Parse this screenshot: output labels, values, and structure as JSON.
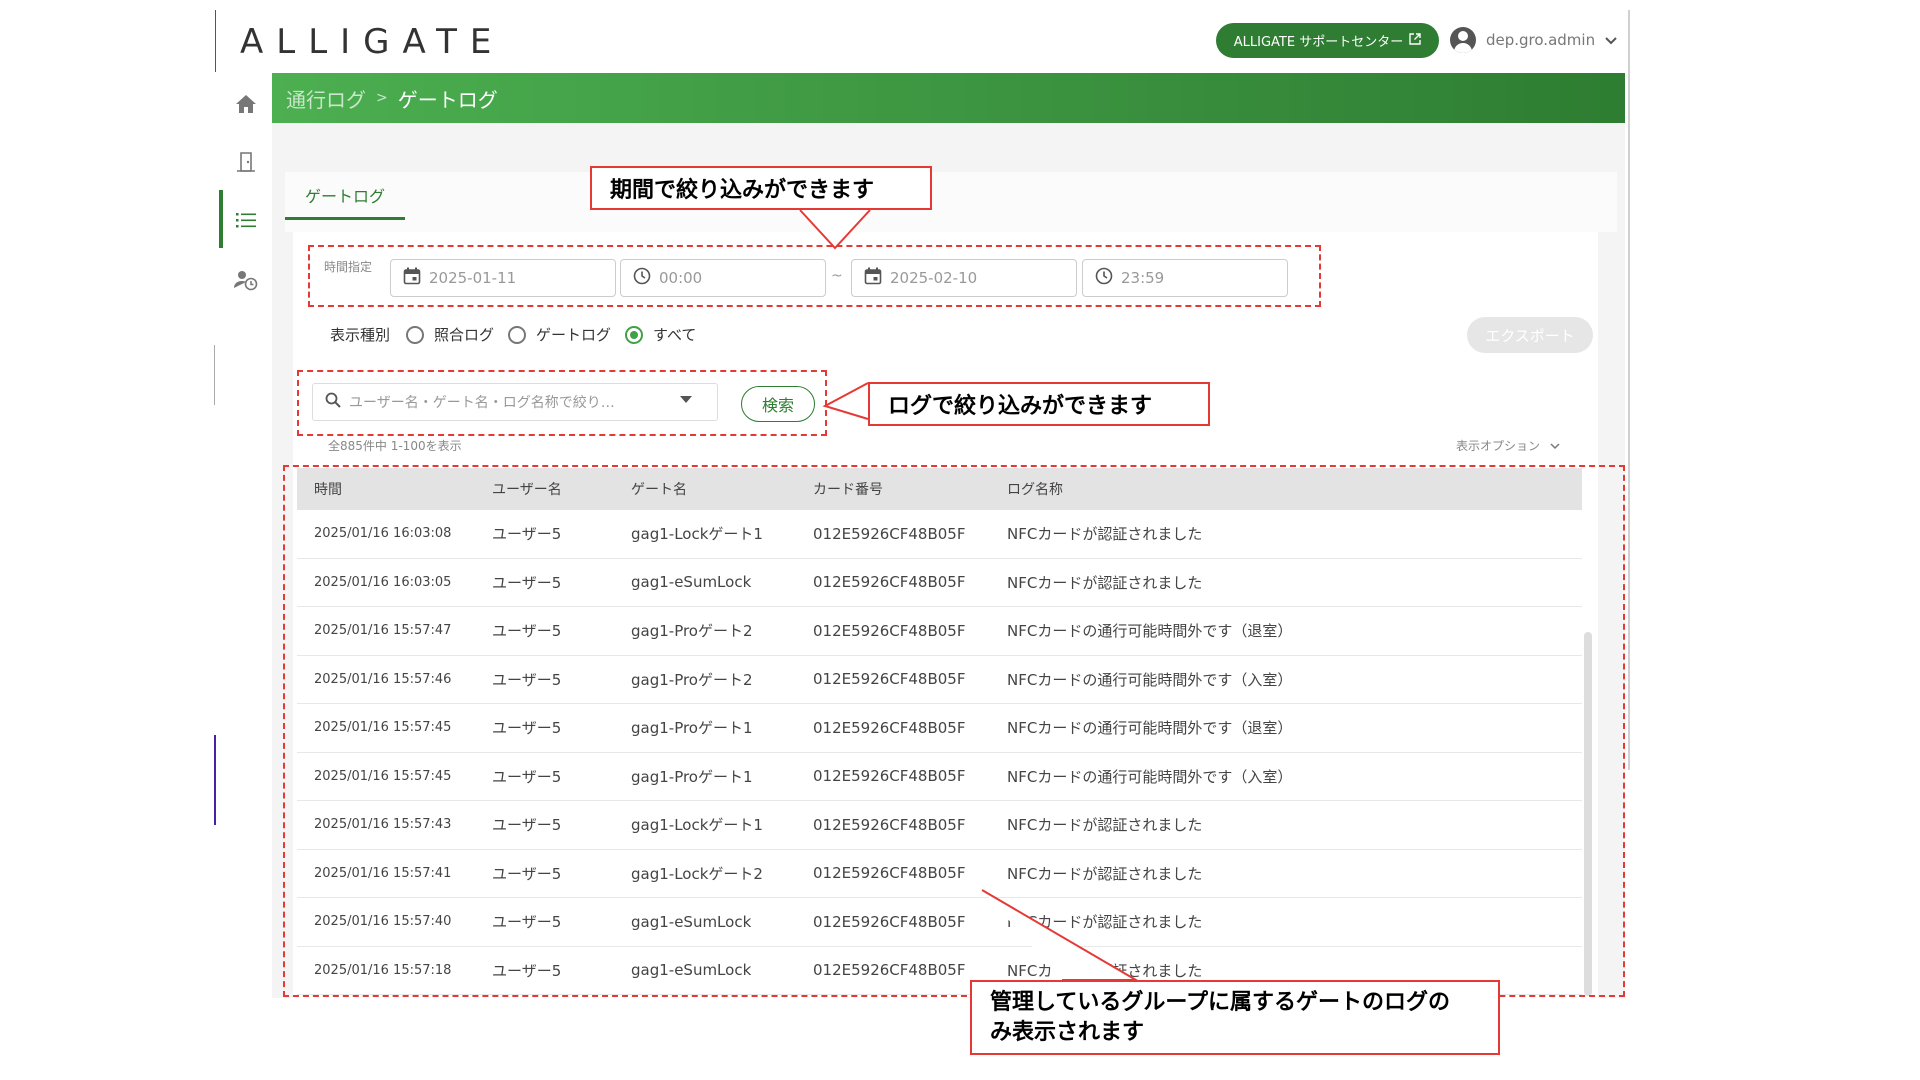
{
  "header": {
    "logo": "ALLIGATE",
    "support_label": "ALLIGATE サポートセンター",
    "user_name": "dep.gro.admin"
  },
  "breadcrumb": {
    "parent": "通行ログ",
    "separator": ">",
    "current": "ゲートログ"
  },
  "tabs": [
    {
      "label": "ゲートログ",
      "active": true
    }
  ],
  "filters": {
    "time_label": "時間指定",
    "start_date": "2025-01-11",
    "start_time": "00:00",
    "tilde": "~",
    "end_date": "2025-02-10",
    "end_time": "23:59",
    "type_label": "表示種別",
    "options": [
      "照合ログ",
      "ゲートログ",
      "すべて"
    ],
    "selected": "すべて",
    "export_label": "エクスポート"
  },
  "search": {
    "placeholder": "ユーザー名・ゲート名・ログ名称で絞り…",
    "button_label": "検索",
    "count_text": "全885件中 1-100を表示",
    "options_label": "表示オプション"
  },
  "table": {
    "columns": [
      "時間",
      "ユーザー名",
      "ゲート名",
      "カード番号",
      "ログ名称"
    ],
    "rows": [
      [
        "2025/01/16 16:03:08",
        "ユーザー5",
        "gag1-Lockゲート1",
        "012E5926CF48B05F",
        "NFCカードが認証されました"
      ],
      [
        "2025/01/16 16:03:05",
        "ユーザー5",
        "gag1-eSumLock",
        "012E5926CF48B05F",
        "NFCカードが認証されました"
      ],
      [
        "2025/01/16 15:57:47",
        "ユーザー5",
        "gag1-Proゲート2",
        "012E5926CF48B05F",
        "NFCカードの通行可能時間外です（退室）"
      ],
      [
        "2025/01/16 15:57:46",
        "ユーザー5",
        "gag1-Proゲート2",
        "012E5926CF48B05F",
        "NFCカードの通行可能時間外です（入室）"
      ],
      [
        "2025/01/16 15:57:45",
        "ユーザー5",
        "gag1-Proゲート1",
        "012E5926CF48B05F",
        "NFCカードの通行可能時間外です（退室）"
      ],
      [
        "2025/01/16 15:57:45",
        "ユーザー5",
        "gag1-Proゲート1",
        "012E5926CF48B05F",
        "NFCカードの通行可能時間外です（入室）"
      ],
      [
        "2025/01/16 15:57:43",
        "ユーザー5",
        "gag1-Lockゲート1",
        "012E5926CF48B05F",
        "NFCカードが認証されました"
      ],
      [
        "2025/01/16 15:57:41",
        "ユーザー5",
        "gag1-Lockゲート2",
        "012E5926CF48B05F",
        "NFCカードが認証されました"
      ],
      [
        "2025/01/16 15:57:40",
        "ユーザー5",
        "gag1-eSumLock",
        "012E5926CF48B05F",
        "NFCカードが認証されました"
      ],
      [
        "2025/01/16 15:57:18",
        "ユーザー5",
        "gag1-eSumLock",
        "012E5926CF48B05F",
        "NFCカードが認証されました"
      ]
    ]
  },
  "annotations": {
    "period": "期間で絞り込みができます",
    "log": "ログで絞り込みができます",
    "group_line1": "管理しているグループに属するゲートのログの",
    "group_line2": "み表示されます"
  },
  "colors": {
    "brand_green": "#2e7d32",
    "annotation_red": "#e53935"
  },
  "icons": {
    "sidebar": [
      "home-icon",
      "door-icon",
      "list-icon",
      "user-clock-icon"
    ]
  }
}
